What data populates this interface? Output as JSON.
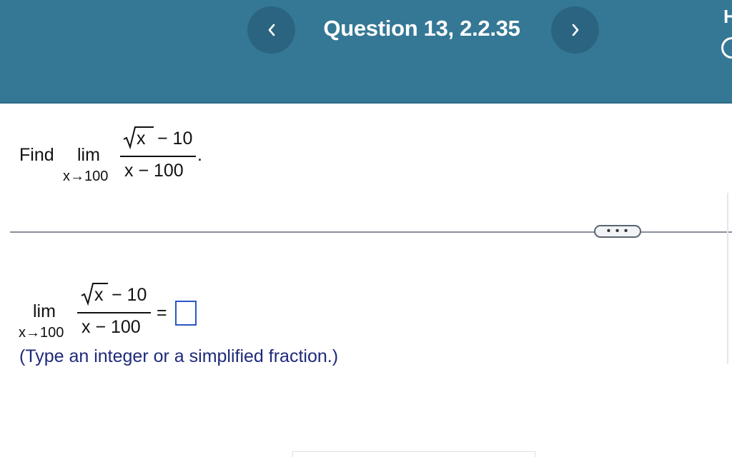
{
  "header": {
    "title": "Question 13, 2.2.35",
    "prev_icon": "chevron-left-icon",
    "next_icon": "chevron-right-icon",
    "corner_text": "H"
  },
  "problem": {
    "find_label": "Find",
    "lim": "lim",
    "limit_sub": "x→100",
    "numerator_var": "x",
    "numerator_rest": "− 10",
    "denominator": "x − 100",
    "period": "."
  },
  "more_button": {
    "label": "• • •"
  },
  "answer": {
    "lim": "lim",
    "limit_sub": "x→100",
    "numerator_var": "x",
    "numerator_rest": "− 10",
    "denominator": "x − 100",
    "equals": "=",
    "value": "",
    "hint": "(Type an integer or a simplified fraction.)"
  },
  "colors": {
    "header_bg": "#357895",
    "nav_button_bg": "#2b6480",
    "hint_text": "#1e2a7a",
    "answer_box_border": "#2a56c6"
  }
}
